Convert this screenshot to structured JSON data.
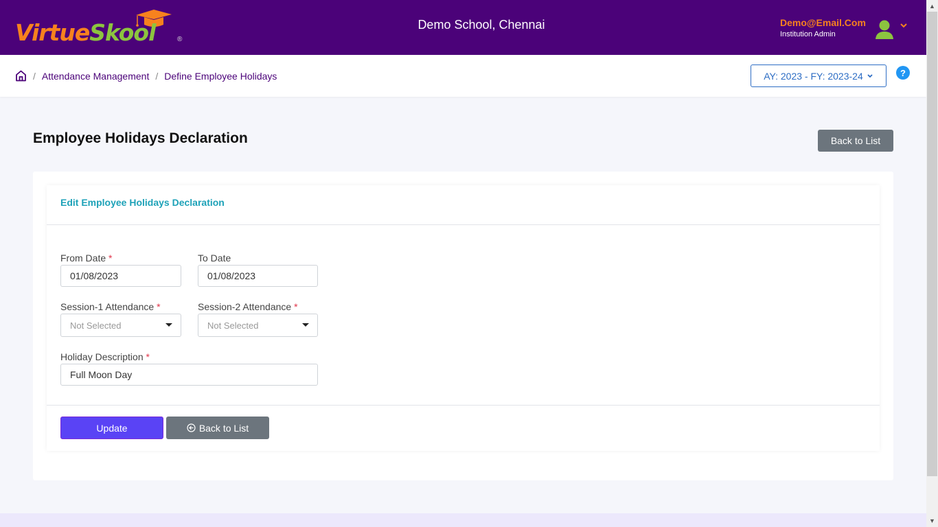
{
  "header": {
    "logo_part1": "Virtue",
    "logo_part2": "Skool",
    "logo_reg": "®",
    "school_name": "Demo School, Chennai",
    "user_email": "Demo@Email.Com",
    "user_role": "Institution Admin"
  },
  "breadcrumb": {
    "items": [
      "Attendance Management",
      "Define Employee Holidays"
    ],
    "separator": "/"
  },
  "year_selector": {
    "value": "AY: 2023 - FY: 2023-24"
  },
  "help": {
    "label": "?"
  },
  "page": {
    "title": "Employee Holidays Declaration",
    "back_to_list_label": "Back to List"
  },
  "form": {
    "card_title": "Edit Employee Holidays Declaration",
    "from_date": {
      "label": "From Date",
      "required": "*",
      "value": "01/08/2023"
    },
    "to_date": {
      "label": "To Date",
      "value": "01/08/2023"
    },
    "session1": {
      "label": "Session-1 Attendance",
      "required": "*",
      "value": "Not Selected"
    },
    "session2": {
      "label": "Session-2 Attendance",
      "required": "*",
      "value": "Not Selected"
    },
    "description": {
      "label": "Holiday Description",
      "required": "*",
      "value": "Full Moon Day"
    },
    "update_label": "Update",
    "back_label": "Back to List"
  },
  "colors": {
    "brand_purple": "#4b0279",
    "brand_orange": "#f7821e",
    "brand_green": "#8cc43f",
    "accent_teal": "#1ea2b8",
    "primary_button": "#5a43f5",
    "secondary_button": "#6c757d"
  }
}
